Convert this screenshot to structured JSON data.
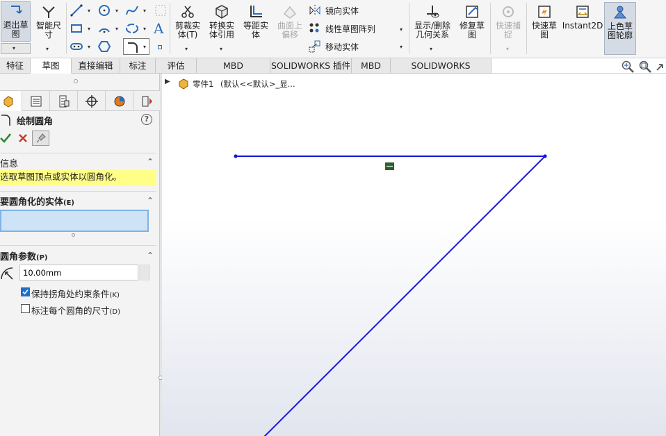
{
  "ribbon": {
    "exit_sketch": "退出草\n图",
    "smart_dimension": "智能尺\n寸",
    "trim": "剪裁实\n体(T)",
    "convert": "转换实\n体引用",
    "offset": "等距实\n体",
    "offset_surface": "曲面上\n偏移",
    "mirror": "镜向实体",
    "linear_pattern": "线性草图阵列",
    "move": "移动实体",
    "show_relations": "显示/删除\n几何关系",
    "repair": "修复草\n图",
    "quick_snap": "快速捕\n捉",
    "rapid_sketch": "快速草\n图",
    "instant2d": "Instant2D",
    "shaded_contours": "上色草\n图轮廓"
  },
  "tabs": [
    {
      "label": "特征"
    },
    {
      "label": "草图"
    },
    {
      "label": "直接编辑"
    },
    {
      "label": "标注"
    },
    {
      "label": "评估"
    },
    {
      "label": "MBD Dimensions"
    },
    {
      "label": "SOLIDWORKS 插件"
    },
    {
      "label": "MBD"
    },
    {
      "label": "SOLIDWORKS Inspection"
    }
  ],
  "panel": {
    "title": "绘制圆角",
    "info_title": "信息",
    "info_text": "选取草图顶点或实体以圆角化。",
    "entities_title": "要圆角化的实体",
    "entities_key": "(E)",
    "params_title": "圆角参数",
    "params_key": "(P)",
    "radius_value": "10.00mm",
    "keep_corner_label": "保持拐角处约束条件",
    "keep_corner_key": "(K)",
    "keep_corner_checked": true,
    "dimension_each_label": "标注每个圆角的尺寸",
    "dimension_each_key": "(D)",
    "dimension_each_checked": false
  },
  "tree": {
    "part_label": "零件1",
    "config_label": "(默认<<默认>_显..."
  },
  "colors": {
    "sketch_line": "#1515d8",
    "info_bg": "#ffff88",
    "selection_box": "#cfe3f7"
  }
}
